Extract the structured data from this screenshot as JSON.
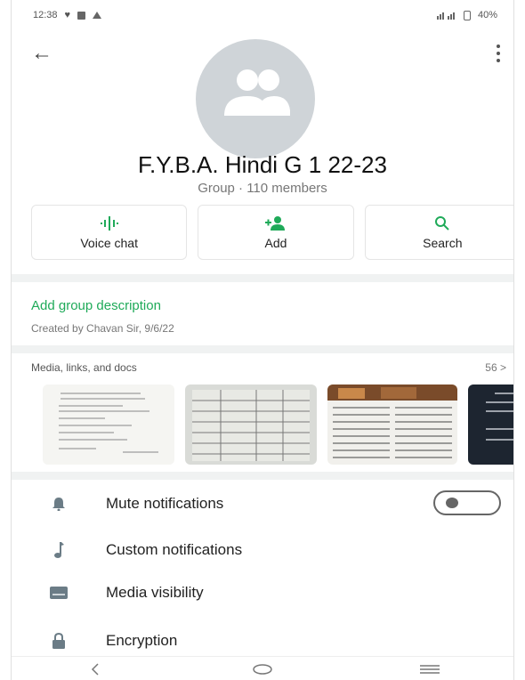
{
  "status_bar": {
    "time": "12:38",
    "right_text": "40%"
  },
  "group": {
    "name": "F.Y.B.A. Hindi G 1 22-23",
    "subtitle": "Group · 110 members"
  },
  "actions": [
    {
      "label": "Voice chat",
      "icon": "voice-chat-icon"
    },
    {
      "label": "Add",
      "icon": "add-person-icon"
    },
    {
      "label": "Search",
      "icon": "search-icon"
    }
  ],
  "description": {
    "link": "Add group description",
    "created": "Created by Chavan Sir, 9/6/22"
  },
  "media": {
    "heading": "Media, links, and docs",
    "count": "56 >"
  },
  "settings": [
    {
      "label": "Mute notifications",
      "icon": "bell-icon"
    },
    {
      "label": "Custom notifications",
      "icon": "music-note-icon"
    },
    {
      "label": "Media visibility",
      "icon": "media-visibility-icon"
    },
    {
      "label": "Encryption",
      "icon": "lock-icon"
    }
  ],
  "colors": {
    "accent": "#1faa59",
    "avatar_bg": "#cfd4d8"
  }
}
